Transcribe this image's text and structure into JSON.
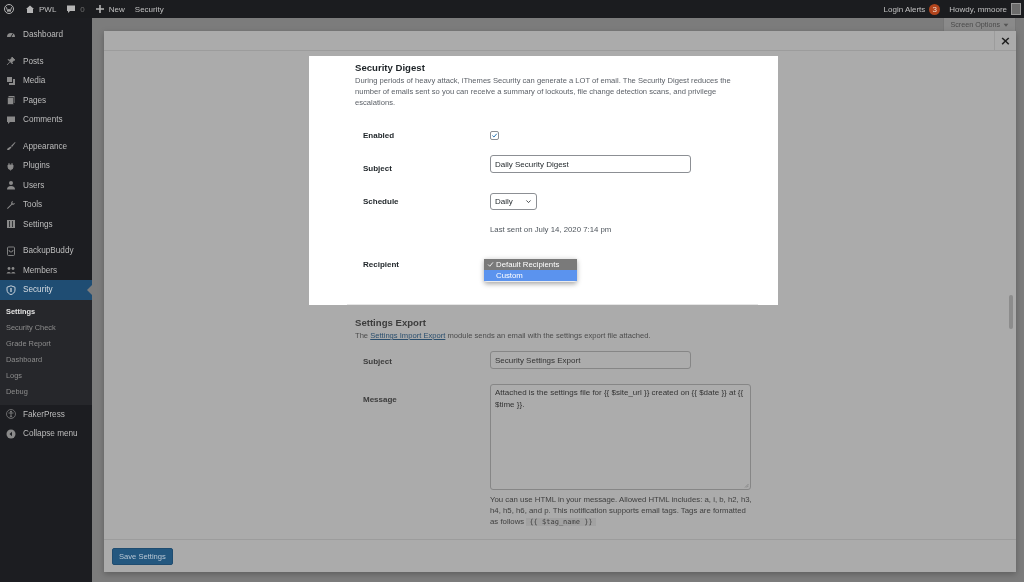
{
  "admin_bar": {
    "items": [
      {
        "kind": "logo"
      },
      {
        "kind": "home",
        "label": "PWL"
      },
      {
        "kind": "comments",
        "label": "0"
      },
      {
        "kind": "new",
        "label": "New"
      },
      {
        "kind": "plain",
        "label": "Security"
      }
    ],
    "login_alerts": {
      "label": "Login Alerts",
      "count": "3"
    },
    "greeting": "Howdy, mmoore"
  },
  "sidebar": {
    "groups": [
      [
        {
          "label": "Dashboard",
          "selected": false
        }
      ],
      [
        {
          "label": "Posts",
          "selected": false
        },
        {
          "label": "Media",
          "selected": false
        },
        {
          "label": "Pages",
          "selected": false
        },
        {
          "label": "Comments",
          "selected": false
        }
      ],
      [
        {
          "label": "Appearance",
          "selected": false
        },
        {
          "label": "Plugins",
          "selected": false
        },
        {
          "label": "Users",
          "selected": false
        },
        {
          "label": "Tools",
          "selected": false
        },
        {
          "label": "Settings",
          "selected": false
        }
      ],
      [
        {
          "label": "BackupBuddy",
          "selected": false
        },
        {
          "label": "Members",
          "selected": false
        },
        {
          "label": "Security",
          "selected": true,
          "children": [
            {
              "label": "Settings",
              "selected": true
            },
            {
              "label": "Security Check",
              "selected": false
            },
            {
              "label": "Grade Report",
              "selected": false
            },
            {
              "label": "Dashboard",
              "selected": false
            },
            {
              "label": "Logs",
              "selected": false
            },
            {
              "label": "Debug",
              "selected": false
            }
          ]
        },
        {
          "label": "FakerPress",
          "selected": false
        },
        {
          "label": "Collapse menu",
          "selected": false
        }
      ]
    ]
  },
  "screen_options": "Screen Options",
  "modal": {
    "close": "×",
    "sections": [
      {
        "title": "Security Digest",
        "highlighted": true,
        "description": [
          {
            "kind": "text",
            "text": "During periods of heavy attack, iThemes Security can generate a LOT of email. The Security Digest reduces the number of emails sent so you can receive a summary of lockouts, file change detection scans, and privilege escalations."
          }
        ],
        "fields": [
          {
            "kind": "checkbox",
            "label": "Enabled",
            "checked": true
          },
          {
            "kind": "text",
            "label": "Subject",
            "value": "Daily Security Digest"
          },
          {
            "kind": "select",
            "label": "Schedule",
            "value": "Daily",
            "note": [
              {
                "kind": "text",
                "text": "Last sent on July 14, 2020 7:14 pm"
              }
            ]
          },
          {
            "kind": "dropdown",
            "label": "Recipient",
            "options": [
              {
                "label": "Default Recipients",
                "selected": true,
                "highlighted": false
              },
              {
                "label": "Custom",
                "selected": false,
                "highlighted": true
              }
            ]
          }
        ]
      },
      {
        "title": "Settings Export",
        "highlighted": false,
        "description": [
          {
            "kind": "text",
            "text": "The "
          },
          {
            "kind": "link",
            "text": "Settings Import Export"
          },
          {
            "kind": "text",
            "text": " module sends an email with the settings export file attached."
          }
        ],
        "fields": [
          {
            "kind": "text",
            "label": "Subject",
            "value": "Security Settings Export"
          },
          {
            "kind": "textarea",
            "label": "Message",
            "value": "Attached is the settings file for {{ $site_url }} created on {{ $date }} at {{ $time }}.",
            "note": [
              {
                "kind": "text",
                "text": "You can use HTML in your message. Allowed HTML includes: a, i, b, h2, h3, h4, h5, h6, and p. This notification supports email tags. Tags are formatted as follows "
              },
              {
                "kind": "code",
                "text": "{{ $tag_name }}"
              }
            ]
          }
        ]
      }
    ],
    "save_button": "Save Settings"
  }
}
